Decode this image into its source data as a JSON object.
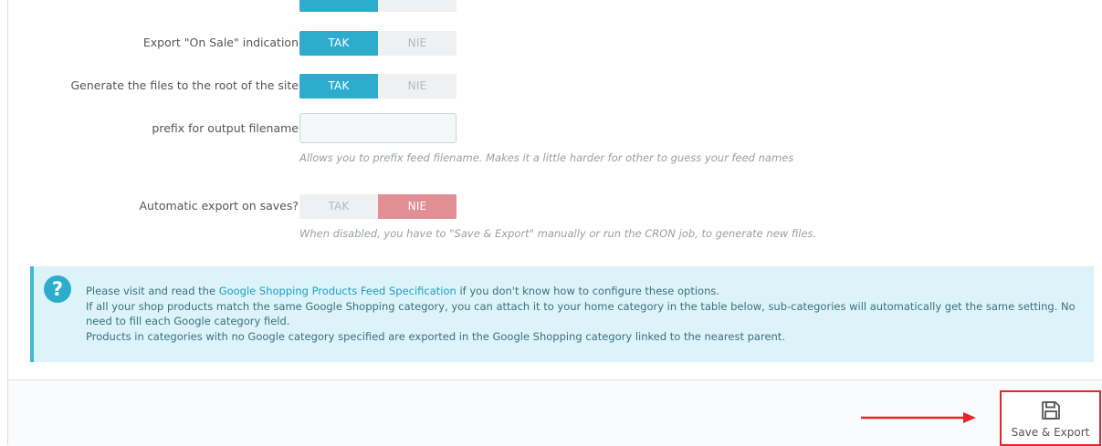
{
  "settings": [
    {
      "label": "Export \"On Sale\" indication",
      "yes": "TAK",
      "no": "NIE",
      "value": "TAK"
    },
    {
      "label": "Generate the files to the root of the site",
      "yes": "TAK",
      "no": "NIE",
      "value": "TAK"
    },
    {
      "label": "prefix for output filename",
      "input_value": "",
      "help": "Allows you to prefix feed filename. Makes it a little harder for other to guess your feed names"
    },
    {
      "label": "Automatic export on saves?",
      "yes": "TAK",
      "no": "NIE",
      "value": "NIE",
      "help": "When disabled, you have to \"Save & Export\" manually or run the CRON job, to generate new files."
    }
  ],
  "alert": {
    "icon": "question-icon",
    "line1_pre": "Please visit and read the ",
    "line1_link": "Google Shopping Products Feed Specification",
    "line1_post": " if you don't know how to configure these options.",
    "line2": "If all your shop products match the same Google Shopping category, you can attach it to your home category in the table below, sub-categories will automatically get the same setting. No need to fill each Google category field.",
    "line3": "Products in categories with no Google category specified are exported in the Google Shopping category linked to the nearest parent."
  },
  "footer": {
    "save_label": "Save & Export",
    "save_icon": "floppy-disk-icon"
  },
  "colors": {
    "accent": "#2eacce",
    "danger_switch": "#e08f95",
    "highlight": "#e5252c"
  }
}
